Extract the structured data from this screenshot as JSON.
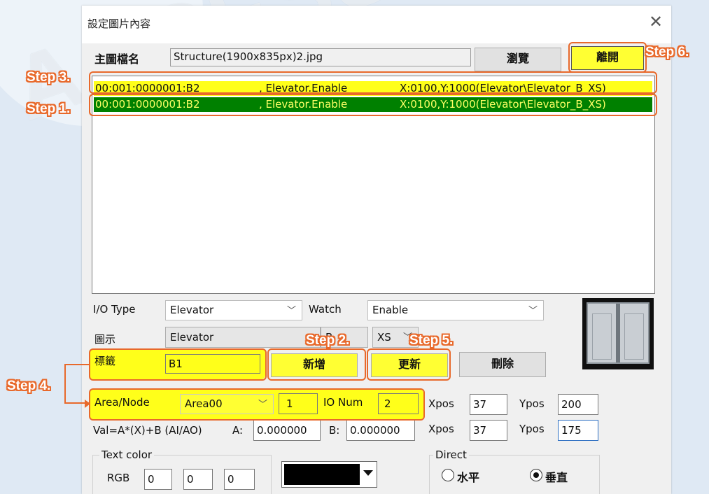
{
  "dialog": {
    "title": "設定圖片內容",
    "close_glyph": "✕",
    "main_image_label": "主圖檔名",
    "main_image_value": "Structure(1900x835px)2.jpg",
    "browse_button": "瀏覽",
    "leave_button": "離開"
  },
  "list": {
    "rows": [
      {
        "id": "00:001:0000001:B2",
        "name": ", Elevator.Enable",
        "pos": "X:0100,Y:1000(Elevator\\Elevator_B_XS)",
        "state": "yellow"
      },
      {
        "id": "00:001:0000001:B2",
        "name": ", Elevator.Enable",
        "pos": "X:0100,Y:1000(Elevator\\Elevator_B_XS)",
        "state": "selected"
      }
    ]
  },
  "form": {
    "io_type_label": "I/O Type",
    "io_type_value": "Elevator",
    "watch_label": "Watch",
    "watch_value": "Enable",
    "icon_label": "圖示",
    "icon_value": "Elevator",
    "icon_variant": "B",
    "icon_size": "XS",
    "tag_label": "標籤",
    "tag_value": "B1",
    "add_button": "新增",
    "update_button": "更新",
    "delete_button": "刪除",
    "area_node_label": "Area/Node",
    "area_value": "Area00",
    "node_value": "1",
    "io_num_label": "IO Num",
    "io_num_value": "2",
    "xpos_label": "Xpos",
    "xpos1_value": "37",
    "ypos_label": "Ypos",
    "ypos1_value": "200",
    "formula_label": "Val=A*(X)+B (AI/AO)",
    "a_label": "A:",
    "a_value": "0.000000",
    "b_label": "B:",
    "b_value": "0.000000",
    "xpos2_value": "37",
    "ypos2_value": "175",
    "text_color_label": "Text color",
    "rgb_label": "RGB",
    "r_value": "0",
    "g_value": "0",
    "b_color_value": "0",
    "direct_label": "Direct",
    "horizontal_label": "水平",
    "vertical_label": "垂直"
  },
  "steps": {
    "s1": "Step 1.",
    "s2": "Step 2.",
    "s3": "Step 3.",
    "s4": "Step 4.",
    "s5": "Step 5.",
    "s6": "Step 6."
  },
  "watermark": "ACCESS & INDUSTRY",
  "colors": {
    "highlight": "#e8692b",
    "selected_row": "#008000",
    "yellow": "#ffff1a"
  }
}
